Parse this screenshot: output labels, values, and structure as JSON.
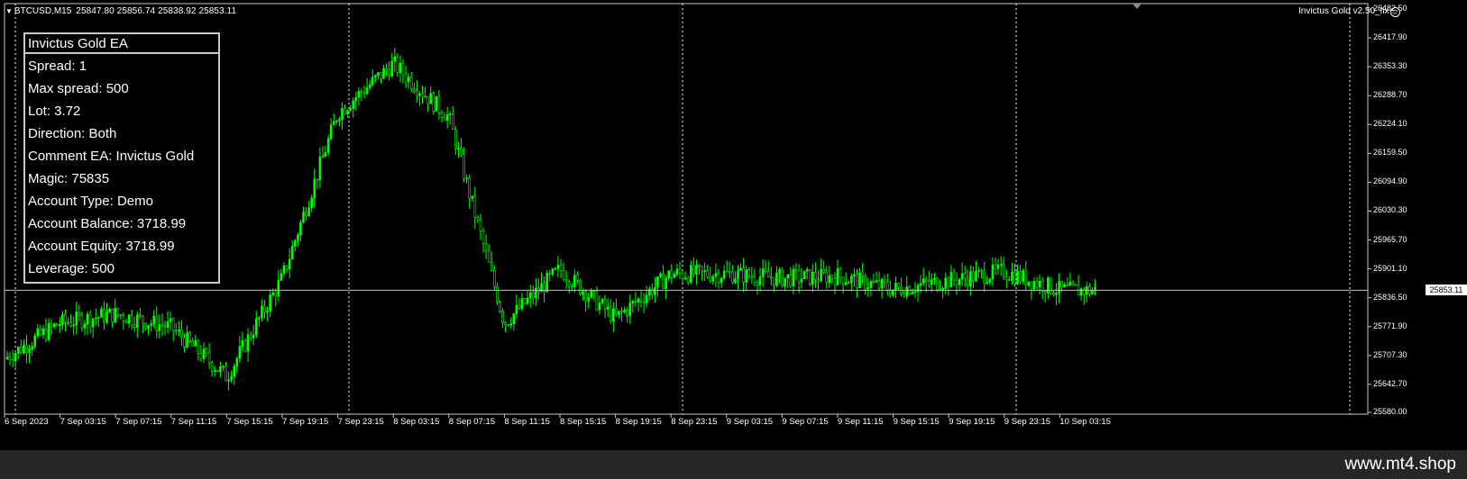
{
  "header": {
    "symbol": "BTCUSD,M15",
    "ohlc": "25847.80 25856.74 25838.92 25853.11"
  },
  "ea_badge": {
    "label": "Invictus Gold v2.50_fix",
    "icon": "smiley-icon"
  },
  "ea_panel": {
    "title": "Invictus Gold EA",
    "rows": [
      "Spread: 1",
      "Max spread: 500",
      "Lot: 3.72",
      "Direction: Both",
      "Comment EA: Invictus Gold",
      "Magic: 75835",
      "Account Type: Demo",
      "Account Balance: 3718.99",
      "Account Equity: 3718.99",
      "Leverage: 500"
    ]
  },
  "current_price": "25853.11",
  "colors": {
    "background": "#000000",
    "candles": "#00ff00",
    "grid": "#ffffff",
    "price_line": "#c0c0c0"
  },
  "price_axis": [
    "26482.50",
    "26417.90",
    "26353.30",
    "26288.70",
    "26224.10",
    "26159.50",
    "26094.90",
    "26030.30",
    "25965.70",
    "25901.10",
    "25836.50",
    "25771.90",
    "25707.30",
    "25642.70",
    "25580.00"
  ],
  "time_axis": [
    "6 Sep 2023",
    "7 Sep 03:15",
    "7 Sep 07:15",
    "7 Sep 11:15",
    "7 Sep 15:15",
    "7 Sep 19:15",
    "7 Sep 23:15",
    "8 Sep 03:15",
    "8 Sep 07:15",
    "8 Sep 11:15",
    "8 Sep 15:15",
    "8 Sep 19:15",
    "8 Sep 23:15",
    "9 Sep 03:15",
    "9 Sep 07:15",
    "9 Sep 11:15",
    "9 Sep 15:15",
    "9 Sep 19:15",
    "9 Sep 23:15",
    "10 Sep 03:15"
  ],
  "footer": {
    "brand": "www.mt4.shop"
  },
  "chart_data": {
    "type": "line",
    "timeframe": "M15",
    "ylim": [
      25580.0,
      26482.5
    ],
    "x": [
      "6 Sep 2023",
      "7 Sep 03:15",
      "7 Sep 07:15",
      "7 Sep 11:15",
      "7 Sep 15:15",
      "7 Sep 19:15",
      "7 Sep 23:15",
      "8 Sep 03:15",
      "8 Sep 07:15",
      "8 Sep 11:15",
      "8 Sep 15:15",
      "8 Sep 19:15",
      "8 Sep 23:15",
      "9 Sep 03:15",
      "9 Sep 07:15",
      "9 Sep 11:15",
      "9 Sep 15:15",
      "9 Sep 19:15",
      "9 Sep 23:15",
      "10 Sep 03:15"
    ],
    "series": [
      {
        "values": [
          25700,
          25780,
          25800,
          25770,
          25660,
          25880,
          26250,
          26360,
          26240,
          25780,
          25900,
          25790,
          25890,
          25890,
          25880,
          25885,
          25855,
          25875,
          25895,
          25853
        ]
      }
    ],
    "current_price": 25853.11
  }
}
